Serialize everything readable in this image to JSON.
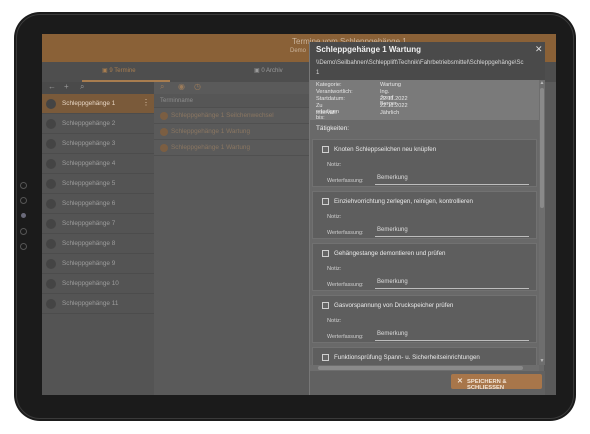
{
  "app": {
    "title": "Termine vom Schleppgehänge 1",
    "subtitle": "Demo"
  },
  "tabs": [
    {
      "label": "9 Termine",
      "active": true
    },
    {
      "label": "0 Archiv",
      "active": false
    }
  ],
  "toolbar": {
    "back_icon": "back-arrow-icon",
    "add_icon": "plus-icon",
    "search_icon": "search-icon"
  },
  "sidebar": {
    "items": [
      {
        "label": "Schleppgehänge 1",
        "active": true
      },
      {
        "label": "Schleppgehänge 2"
      },
      {
        "label": "Schleppgehänge 3"
      },
      {
        "label": "Schleppgehänge 4"
      },
      {
        "label": "Schleppgehänge 5"
      },
      {
        "label": "Schleppgehänge 6"
      },
      {
        "label": "Schleppgehänge 7"
      },
      {
        "label": "Schleppgehänge 8"
      },
      {
        "label": "Schleppgehänge 9"
      },
      {
        "label": "Schleppgehänge 10"
      },
      {
        "label": "Schleppgehänge 11"
      }
    ]
  },
  "table": {
    "column_header": "Terminname",
    "rows": [
      {
        "label": "Schleppgehänge 1 Seilchenwechsel"
      },
      {
        "label": "Schleppgehänge 1 Wartung"
      },
      {
        "label": "Schleppgehänge 1 Wartung"
      }
    ]
  },
  "modal": {
    "title": "Schleppgehänge 1 Wartung",
    "path_line1": "\\\\Demo\\Seilbahnen\\Schlepplift\\Technik\\Fahrbetriebsmittel\\Schleppgehänge\\Sc",
    "path_line2": "1",
    "meta": {
      "kategorie_label": "Kategorie:",
      "kategorie": "Wartung",
      "verantwortlich_label": "Verantwortlich:",
      "verantwortlich": "Ing. Josef Berger",
      "startdatum_label": "Startdatum:",
      "startdatum": "22.11.2022",
      "erledigen_label": "Zu erledigen bis:",
      "erledigen": "22.11.2022",
      "intervall_label": "Intervall:",
      "intervall": "Jährlich"
    },
    "tasks_label": "Tätigkeiten:",
    "notiz_label": "Notiz:",
    "werterfassung_label": "Werterfassung:",
    "tasks": [
      {
        "title": "Knoten Schleppseilchen neu knüpfen",
        "value": "Bemerkung"
      },
      {
        "title": "Einziehvorrichtung zerlegen, reinigen, kontrollieren",
        "value": "Bemerkung"
      },
      {
        "title": "Gehängestange demontieren und prüfen",
        "value": "Bemerkung"
      },
      {
        "title": "Gasvorspannung von Druckspeicher prüfen",
        "value": "Bemerkung"
      },
      {
        "title": "Funktionsprüfung Spann- u. Sicherheitseinrichtungen",
        "value": ""
      }
    ],
    "save_button": "SPEICHERN & SCHLIESSEN",
    "close_icon": "close-icon"
  },
  "colors": {
    "accent": "#a8764a",
    "header": "#8a6137"
  }
}
